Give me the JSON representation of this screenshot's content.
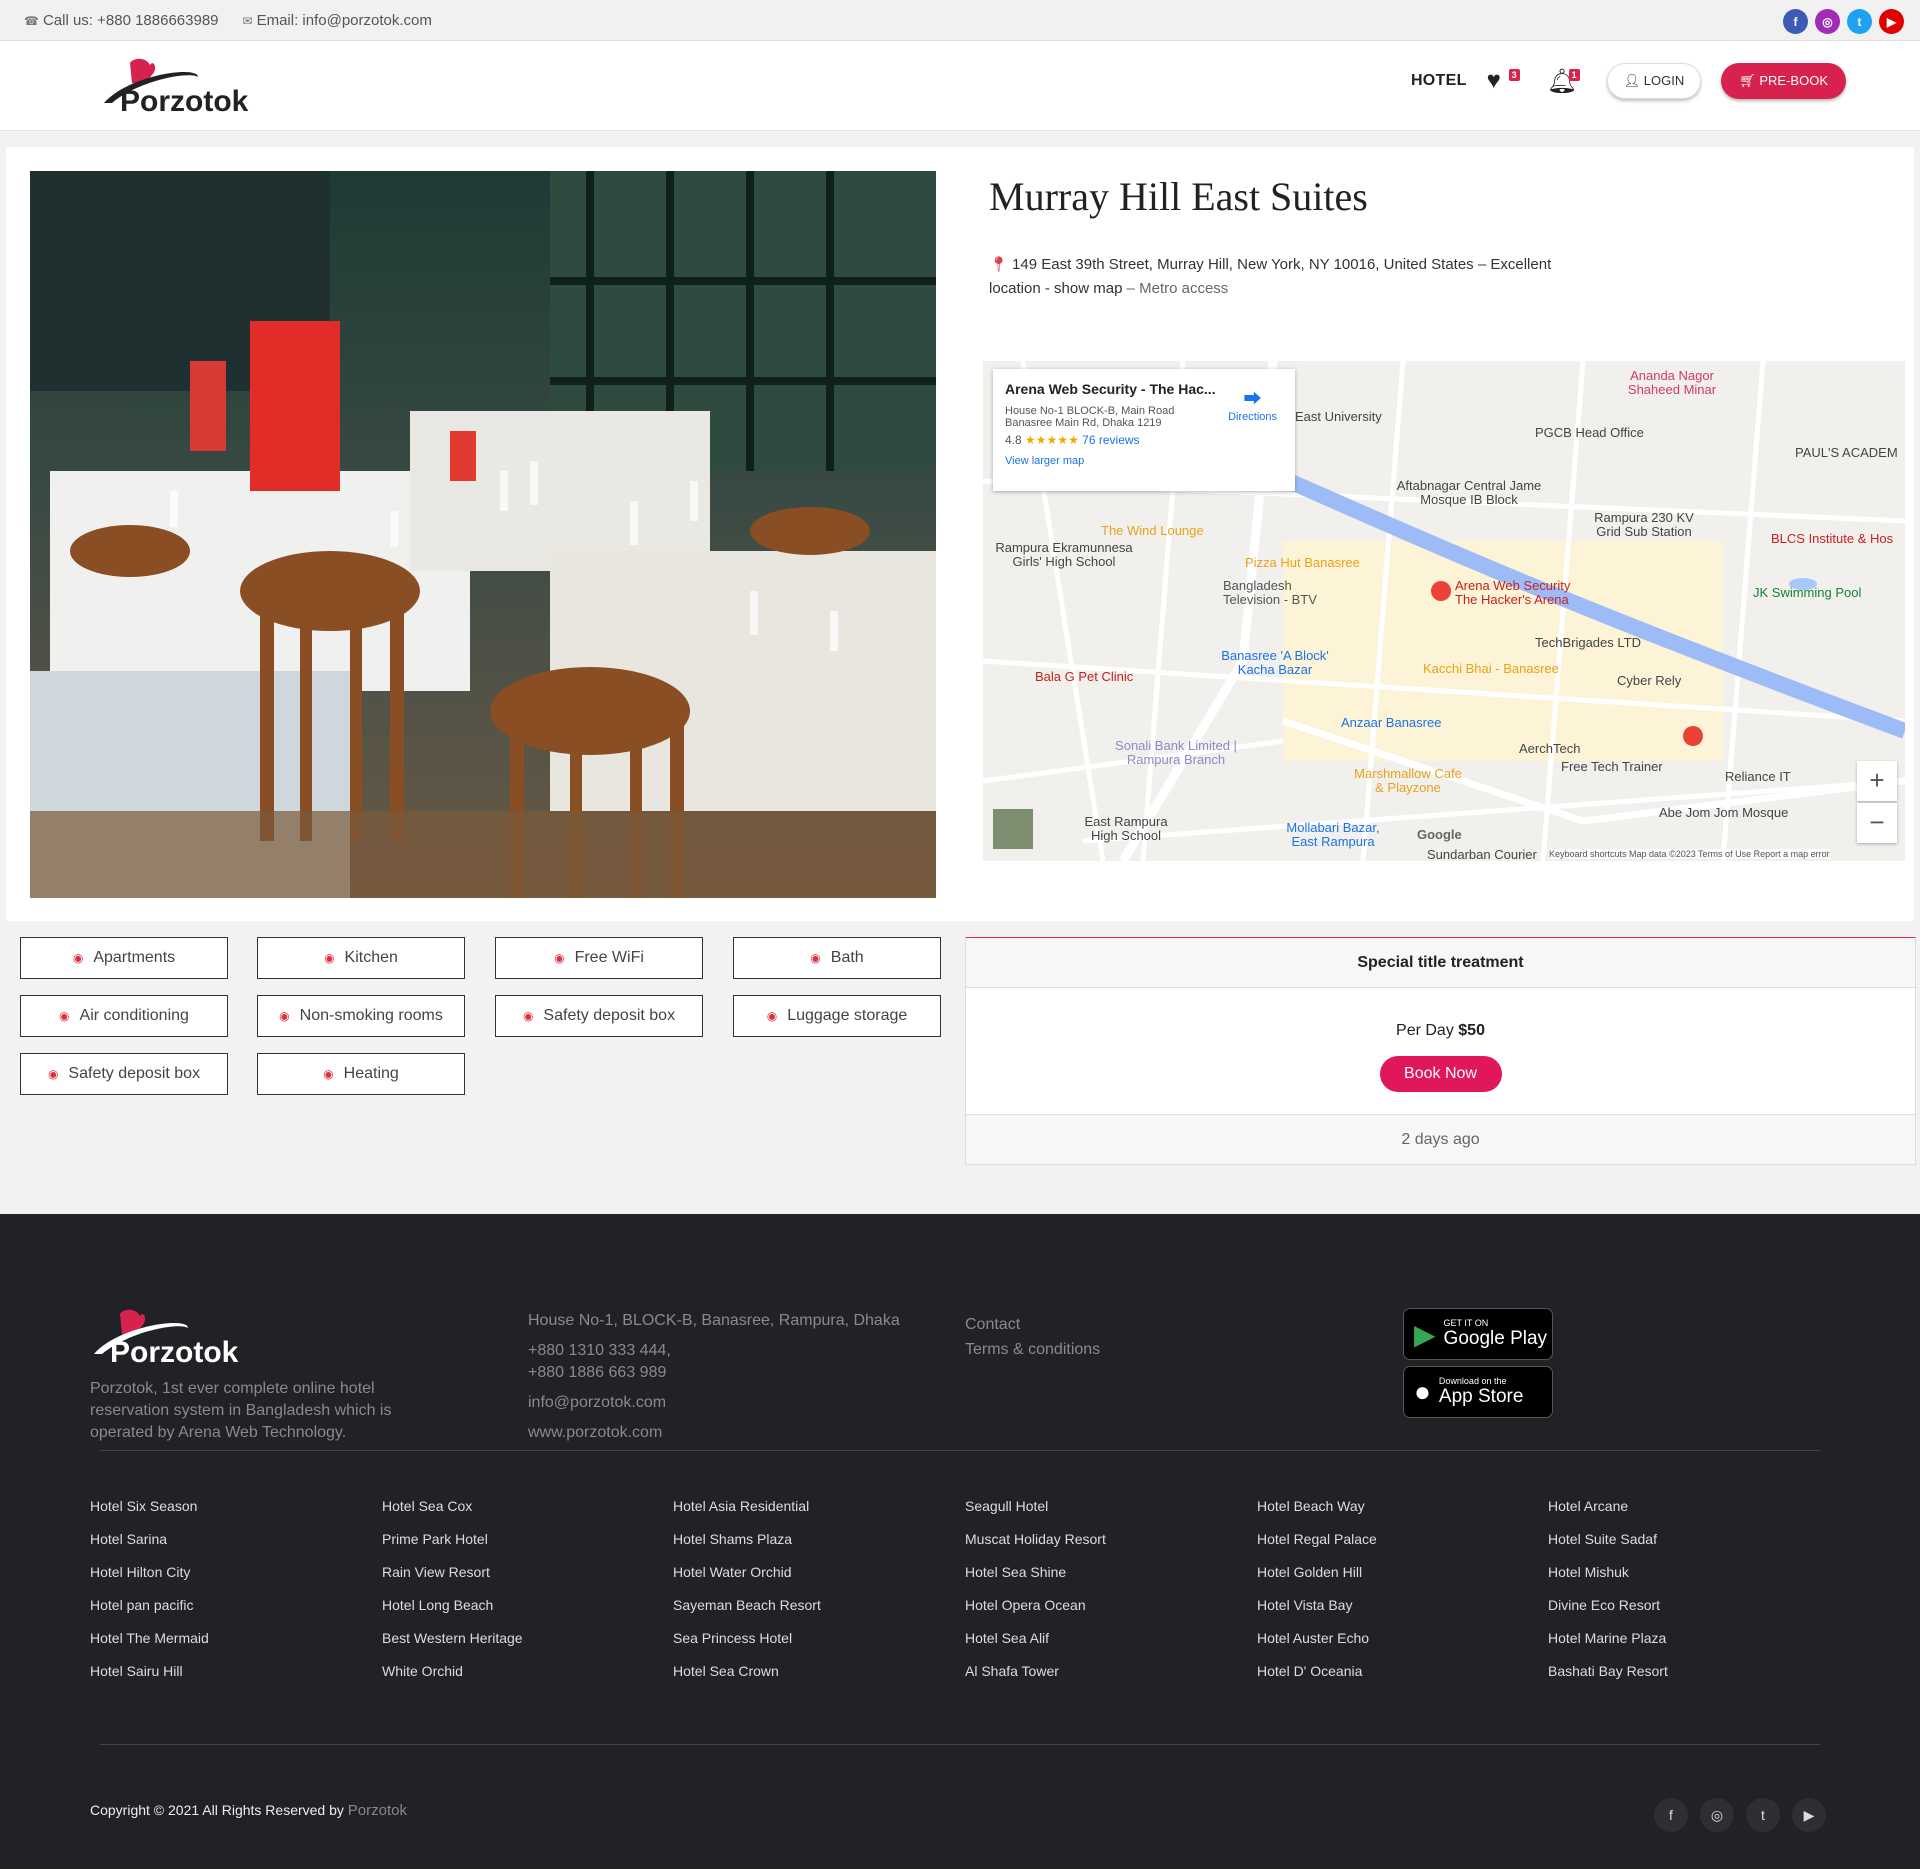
{
  "topbar": {
    "phone": "Call us: +880 1886663989",
    "email": "Email: info@porzotok.com"
  },
  "brand": {
    "name": "Porzotok"
  },
  "nav": {
    "hotel": "HOTEL",
    "wishlist_count": "3",
    "notification_count": "1",
    "login": "LOGIN",
    "prebook": "PRE-BOOK"
  },
  "hotel": {
    "title": "Murray Hill East Suites",
    "address": "149 East 39th Street, Murray Hill, New York, NY 10016, United States",
    "address_note": "– Excellent location -",
    "show_map": "show map",
    "metro": "– Metro access"
  },
  "map": {
    "card_title": "Arena Web Security - The Hac...",
    "card_address_1": "House No-1 BLOCK-B, Main Road",
    "card_address_2": "Banasree Main Rd, Dhaka 1219",
    "rating": "4.8",
    "stars": "★★★★★",
    "reviews": "76 reviews",
    "directions": "Directions",
    "larger_map": "View larger map",
    "labels": {
      "east_university": "East University",
      "ananda": "Ananda Nagor Shaheed Minar",
      "pgcb": "PGCB Head Office",
      "paul": "PAUL'S ACADEM",
      "aftabnagar": "Aftabnagar Central Jame Mosque IB Block",
      "rampura_kv": "Rampura 230 KV Grid Sub Station",
      "blcs": "BLCS Institute & Hos",
      "wind_lounge": "The Wind Lounge",
      "ekramunnesa": "Rampura Ekramunnesa Girls' High School",
      "pizza_hut": "Pizza Hut Banasree",
      "btv": "Bangladesh Television - BTV",
      "arena": "Arena Web Security The Hacker's Arena",
      "jk_pool": "JK Swimming Pool",
      "techbrigades": "TechBrigades LTD",
      "banasree_a": "Banasree 'A Block' Kacha Bazar",
      "kacchi": "Kacchi Bhai - Banasree",
      "cyber_rely": "Cyber Rely",
      "bala_g": "Bala G Pet Clinic",
      "anzaar": "Anzaar Banasree",
      "sonali": "Sonali Bank Limited | Rampura Branch",
      "aerchtech": "AerchTech",
      "free_tech": "Free Tech Trainer",
      "reliance": "Reliance IT",
      "marshmallow": "Marshmallow Cafe & Playzone",
      "abe_jom": "Abe Jom Jom Mosque",
      "east_rampura": "East Rampura High School",
      "mollabari": "Mollabari Bazar, East Rampura",
      "sundarban": "Sundarban Courier",
      "google": "Google",
      "footer_text": "Keyboard shortcuts   Map data ©2023   Terms of Use   Report a map error"
    }
  },
  "amenities": [
    "Apartments",
    "Kitchen",
    "Free WiFi",
    "Bath",
    "Air conditioning",
    "Non-smoking rooms",
    "Safety deposit box",
    "Luggage storage",
    "Safety deposit box",
    "Heating"
  ],
  "special": {
    "title": "Special title treatment",
    "per_day": "Per Day",
    "price": "$50",
    "book": "Book Now",
    "time": "2 days ago"
  },
  "footer": {
    "about": "Porzotok, 1st ever complete online hotel reservation system in Bangladesh which is operated by Arena Web Technology.",
    "address": "House No-1, BLOCK-B, Banasree, Rampura, Dhaka",
    "phone1": "+880 1310 333 444,",
    "phone2": "+880 1886 663 989",
    "email": "info@porzotok.com",
    "website": "www.porzotok.com",
    "contact": "Contact",
    "terms": "Terms & conditions",
    "google_small": "GET IT ON",
    "google_big": "Google Play",
    "apple_small": "Download on the",
    "apple_big": "App Store",
    "hotels": [
      [
        "Hotel Six Season",
        "Hotel Sarina",
        "Hotel Hilton City",
        "Hotel pan pacific",
        "Hotel The Mermaid",
        "Hotel Sairu Hill"
      ],
      [
        "Hotel Sea Cox",
        "Prime Park Hotel",
        "Rain View Resort",
        "Hotel Long Beach",
        "Best Western Heritage",
        "White Orchid"
      ],
      [
        "Hotel Asia Residential",
        "Hotel Shams Plaza",
        "Hotel Water Orchid",
        "Sayeman Beach Resort",
        "Sea Princess Hotel",
        "Hotel Sea Crown"
      ],
      [
        "Seagull Hotel",
        "Muscat Holiday Resort",
        "Hotel Sea Shine",
        "Hotel Opera Ocean",
        "Hotel Sea Alif",
        "Al Shafa Tower"
      ],
      [
        "Hotel Beach Way",
        "Hotel Regal Palace",
        "Hotel Golden Hill",
        "Hotel Vista Bay",
        "Hotel Auster Echo",
        "Hotel D' Oceania"
      ],
      [
        "Hotel Arcane",
        "Hotel Suite Sadaf",
        "Hotel Mishuk",
        "Divine Eco Resort",
        "Hotel Marine Plaza",
        "Bashati Bay Resort"
      ]
    ],
    "copyright": "Copyright © 2021 All Rights Reserved by",
    "copyright_brand": "Porzotok"
  },
  "colors": {
    "accent": "#d6224c",
    "footer_bg": "#212226",
    "facebook": "#3b5bb5",
    "instagram": "#a02bb5",
    "twitter": "#1da1f2",
    "youtube": "#e00000"
  },
  "icons": {
    "social_top": [
      "facebook-icon",
      "instagram-icon",
      "twitter-icon",
      "youtube-icon"
    ],
    "social_footer": [
      "facebook-icon",
      "instagram-icon",
      "twitter-icon",
      "youtube-icon"
    ]
  }
}
